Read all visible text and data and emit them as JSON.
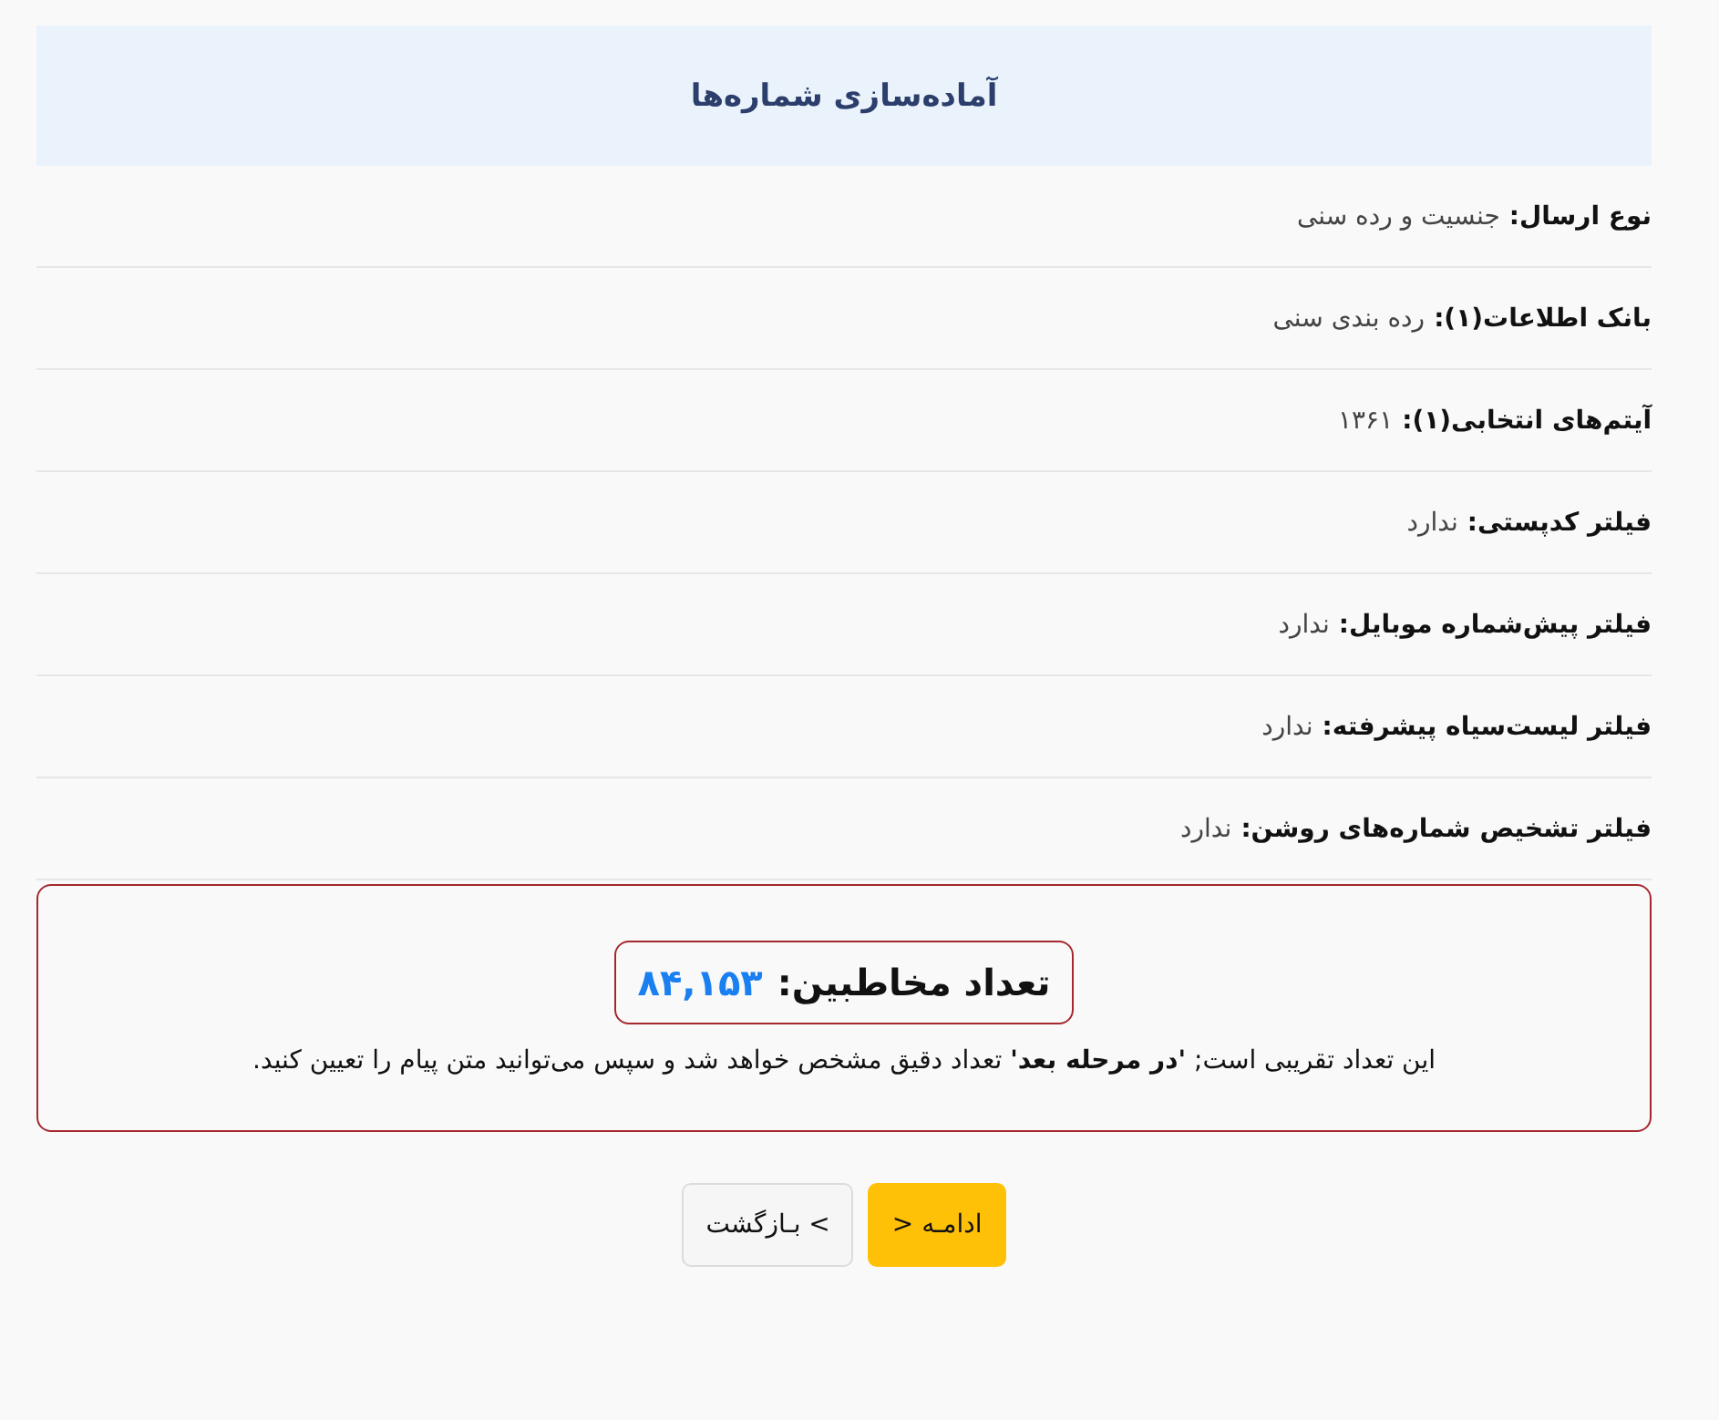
{
  "header": {
    "title": "آماده‌سازی شماره‌ها"
  },
  "details": [
    {
      "label": "نوع ارسال:",
      "value": "جنسیت و رده سنی"
    },
    {
      "label": "بانک اطلاعات(۱):",
      "value": "رده بندی سنی"
    },
    {
      "label": "آیتم‌های انتخابی(۱):",
      "value": "۱۳۶۱"
    },
    {
      "label": "فیلتر کدپستی:",
      "value": "ندارد"
    },
    {
      "label": "فیلتر پیش‌شماره موبایل:",
      "value": "ندارد"
    },
    {
      "label": "فیلتر لیست‌سیاه پیشرفته:",
      "value": "ندارد"
    },
    {
      "label": "فیلتر تشخیص شماره‌های روشن:",
      "value": "ندارد"
    }
  ],
  "summary": {
    "count_label": "تعداد مخاطبین:",
    "count": "۸۴,۱۵۳",
    "note": "این تعداد تقریبی است; **'در مرحله بعد'** تعداد دقیق مشخص خواهد شد و سپس می‌توانید متن پیام را تعیین کنید."
  },
  "buttons": [
    {
      "kind": "primary",
      "label": "ادامـه <"
    },
    {
      "kind": "secondary",
      "label": "> بـازگشت"
    }
  ]
}
